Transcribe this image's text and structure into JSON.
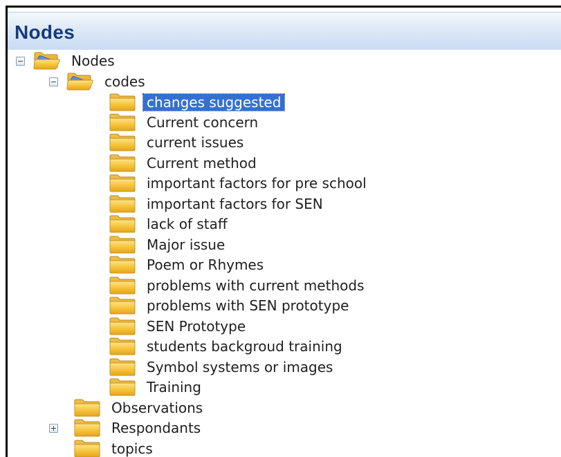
{
  "panel": {
    "title": "Nodes"
  },
  "tree": {
    "root": {
      "label": "Nodes",
      "state": "expanded"
    },
    "codes": {
      "label": "codes",
      "state": "expanded"
    },
    "code_items": [
      {
        "label": "changes suggested",
        "selected": true
      },
      {
        "label": "Current concern"
      },
      {
        "label": "current issues"
      },
      {
        "label": "Current method"
      },
      {
        "label": "important factors for pre school"
      },
      {
        "label": "important factors for SEN"
      },
      {
        "label": "lack of staff"
      },
      {
        "label": "Major issue"
      },
      {
        "label": "Poem or Rhymes"
      },
      {
        "label": "problems with current methods"
      },
      {
        "label": "problems with SEN prototype"
      },
      {
        "label": "SEN Prototype"
      },
      {
        "label": "students backgroud training"
      },
      {
        "label": "Symbol systems or images"
      },
      {
        "label": "Training"
      }
    ],
    "siblings": [
      {
        "label": "Observations"
      },
      {
        "label": "Respondants",
        "state": "collapsed"
      },
      {
        "label": "topics"
      }
    ]
  },
  "icons": {
    "expanded": "minus-box-icon",
    "collapsed": "plus-box-icon",
    "folder": "folder-icon",
    "open_folder": "open-folder-icon"
  },
  "colors": {
    "selection": "#3470d0",
    "header_title": "#173a7a",
    "folder": "#f6c239"
  }
}
